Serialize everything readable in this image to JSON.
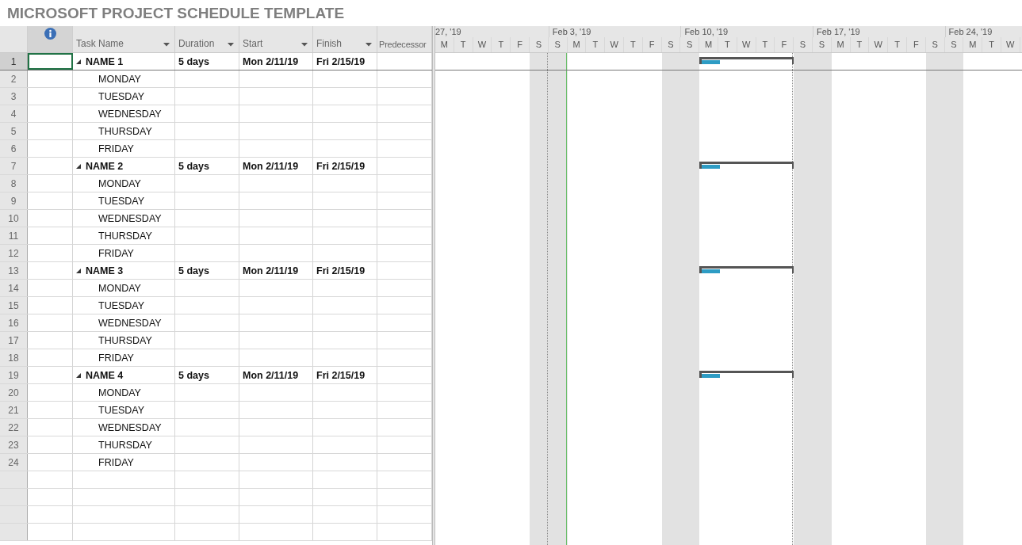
{
  "title": "MICROSOFT PROJECT SCHEDULE TEMPLATE",
  "columns": [
    {
      "label": "Task Name",
      "filter": true
    },
    {
      "label": "Duration",
      "filter": true
    },
    {
      "label": "Start",
      "filter": true
    },
    {
      "label": "Finish",
      "filter": true
    },
    {
      "label": "Predecessor",
      "filter": false
    }
  ],
  "timescale": [
    {
      "label": "27, '19",
      "days": [
        {
          "label": "M",
          "nonworking": false
        },
        {
          "label": "T",
          "nonworking": false
        },
        {
          "label": "W",
          "nonworking": false
        },
        {
          "label": "T",
          "nonworking": false
        },
        {
          "label": "F",
          "nonworking": false
        },
        {
          "label": "S",
          "nonworking": true
        }
      ]
    },
    {
      "label": "Feb 3, '19",
      "days": [
        {
          "label": "S",
          "nonworking": true
        },
        {
          "label": "M",
          "nonworking": false
        },
        {
          "label": "T",
          "nonworking": false
        },
        {
          "label": "W",
          "nonworking": false
        },
        {
          "label": "T",
          "nonworking": false
        },
        {
          "label": "F",
          "nonworking": false
        },
        {
          "label": "S",
          "nonworking": true
        }
      ]
    },
    {
      "label": "Feb 10, '19",
      "days": [
        {
          "label": "S",
          "nonworking": true
        },
        {
          "label": "M",
          "nonworking": false
        },
        {
          "label": "T",
          "nonworking": false
        },
        {
          "label": "W",
          "nonworking": false
        },
        {
          "label": "T",
          "nonworking": false
        },
        {
          "label": "F",
          "nonworking": false
        },
        {
          "label": "S",
          "nonworking": true
        }
      ]
    },
    {
      "label": "Feb 17, '19",
      "days": [
        {
          "label": "S",
          "nonworking": true
        },
        {
          "label": "M",
          "nonworking": false
        },
        {
          "label": "T",
          "nonworking": false
        },
        {
          "label": "W",
          "nonworking": false
        },
        {
          "label": "T",
          "nonworking": false
        },
        {
          "label": "F",
          "nonworking": false
        },
        {
          "label": "S",
          "nonworking": true
        }
      ]
    },
    {
      "label": "Feb 24, '19",
      "days": [
        {
          "label": "S",
          "nonworking": true
        },
        {
          "label": "M",
          "nonworking": false
        },
        {
          "label": "T",
          "nonworking": false
        },
        {
          "label": "W",
          "nonworking": false
        }
      ]
    }
  ],
  "rows": [
    {
      "id": "1",
      "kind": "summary",
      "name": "NAME 1",
      "expanded": true,
      "duration": "5 days",
      "start": "Mon 2/11/19",
      "finish": "Fri 2/15/19",
      "level": 0.2,
      "selected": true
    },
    {
      "id": "2",
      "kind": "task",
      "name": "MONDAY",
      "selected": false
    },
    {
      "id": "3",
      "kind": "task",
      "name": "TUESDAY",
      "selected": false
    },
    {
      "id": "4",
      "kind": "task",
      "name": "WEDNESDAY",
      "selected": false
    },
    {
      "id": "5",
      "kind": "task",
      "name": "THURSDAY",
      "selected": false
    },
    {
      "id": "6",
      "kind": "task",
      "name": "FRIDAY",
      "selected": false
    },
    {
      "id": "7",
      "kind": "summary",
      "name": "NAME 2",
      "expanded": true,
      "duration": "5 days",
      "start": "Mon 2/11/19",
      "finish": "Fri 2/15/19",
      "level": 0.2,
      "selected": false
    },
    {
      "id": "8",
      "kind": "task",
      "name": "MONDAY",
      "selected": false
    },
    {
      "id": "9",
      "kind": "task",
      "name": "TUESDAY",
      "selected": false
    },
    {
      "id": "10",
      "kind": "task",
      "name": "WEDNESDAY",
      "selected": false
    },
    {
      "id": "11",
      "kind": "task",
      "name": "THURSDAY",
      "selected": false
    },
    {
      "id": "12",
      "kind": "task",
      "name": "FRIDAY",
      "selected": false
    },
    {
      "id": "13",
      "kind": "summary",
      "name": "NAME 3",
      "expanded": true,
      "duration": "5 days",
      "start": "Mon 2/11/19",
      "finish": "Fri 2/15/19",
      "level": 0.2,
      "selected": false
    },
    {
      "id": "14",
      "kind": "task",
      "name": "MONDAY",
      "selected": false
    },
    {
      "id": "15",
      "kind": "task",
      "name": "TUESDAY",
      "selected": false
    },
    {
      "id": "16",
      "kind": "task",
      "name": "WEDNESDAY",
      "selected": false
    },
    {
      "id": "17",
      "kind": "task",
      "name": "THURSDAY",
      "selected": false
    },
    {
      "id": "18",
      "kind": "task",
      "name": "FRIDAY",
      "selected": false
    },
    {
      "id": "19",
      "kind": "summary",
      "name": "NAME 4",
      "expanded": true,
      "duration": "5 days",
      "start": "Mon 2/11/19",
      "finish": "Fri 2/15/19",
      "level": 0.2,
      "selected": false
    },
    {
      "id": "20",
      "kind": "task",
      "name": "MONDAY",
      "selected": false
    },
    {
      "id": "21",
      "kind": "task",
      "name": "TUESDAY",
      "selected": false
    },
    {
      "id": "22",
      "kind": "task",
      "name": "WEDNESDAY",
      "selected": false
    },
    {
      "id": "23",
      "kind": "task",
      "name": "THURSDAY",
      "selected": false
    },
    {
      "id": "24",
      "kind": "task",
      "name": "FRIDAY",
      "selected": false
    }
  ]
}
